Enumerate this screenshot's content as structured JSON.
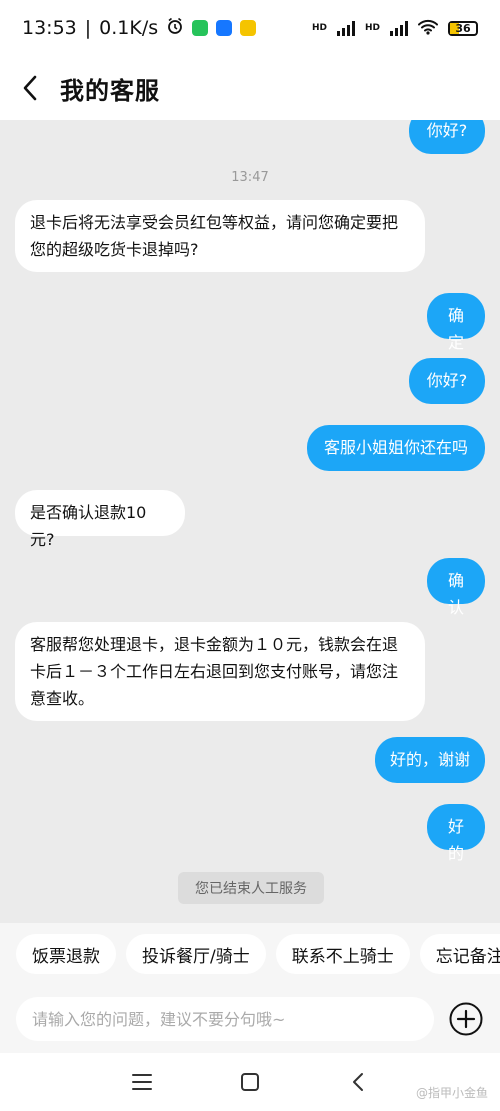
{
  "status_bar": {
    "time": "13:53",
    "speed": "0.1K/s",
    "battery": "36",
    "battery_level": 0.36,
    "network_label_1": "HD",
    "network_label_2": "HD",
    "colors": {
      "wechat": "#26c35a",
      "alipay": "#1677ff",
      "taobao": "#f5c400"
    }
  },
  "header": {
    "title": "我的客服"
  },
  "chat": {
    "timestamp": "13:47",
    "messages": [
      {
        "side": "right",
        "text": "你好?"
      },
      {
        "side": "left",
        "text": "退卡后将无法享受会员红包等权益，请问您确定要把您的超级吃货卡退掉吗?"
      },
      {
        "side": "right",
        "text": "确定"
      },
      {
        "side": "right",
        "text": "你好?"
      },
      {
        "side": "right",
        "text": "客服小姐姐你还在吗"
      },
      {
        "side": "left",
        "text": "是否确认退款10元?"
      },
      {
        "side": "right",
        "text": "确认"
      },
      {
        "side": "left",
        "text": "客服帮您处理退卡，退卡金额为１０元，钱款会在退卡后１－３个工作日左右退回到您支付账号，请您注意查收。"
      },
      {
        "side": "right",
        "text": "好的，谢谢"
      },
      {
        "side": "right",
        "text": "好的"
      }
    ],
    "system_note": "您已结束人工服务"
  },
  "quick_replies": [
    "饭票退款",
    "投诉餐厅/骑士",
    "联系不上骑士",
    "忘记备注"
  ],
  "input": {
    "placeholder": "请输入您的问题，建议不要分句哦~",
    "value": ""
  },
  "watermark": "@指甲小金鱼",
  "colors": {
    "accent": "#1ca6f7",
    "chat_bg": "#ebebeb"
  }
}
